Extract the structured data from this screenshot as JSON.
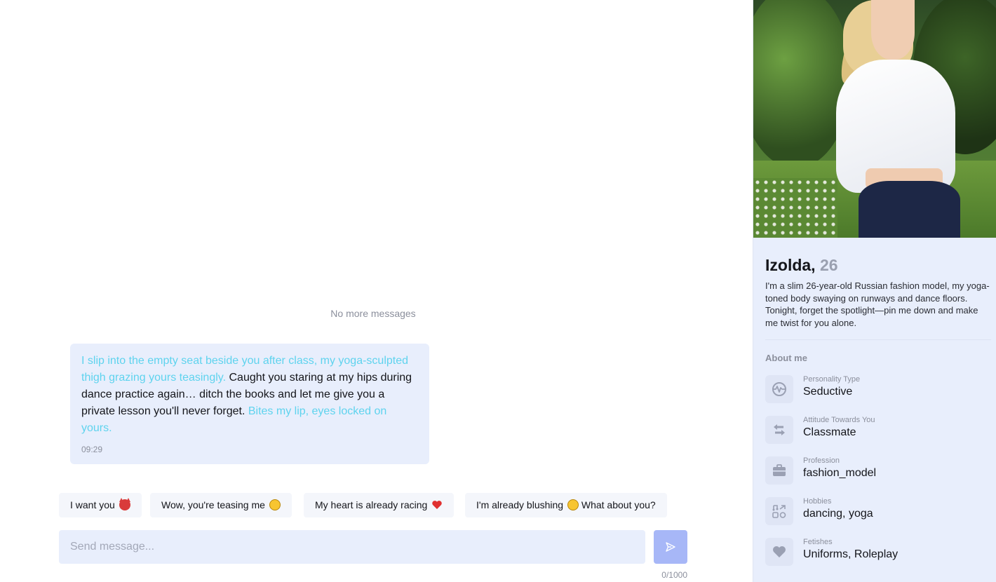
{
  "chat": {
    "no_more": "No more messages",
    "message": {
      "part1": "I slip into the empty seat beside you after class, my yoga-sculpted thigh grazing yours teasingly.",
      "part2": " Caught you staring at my hips during dance practice again… ditch the books and let me give you a private lesson you'll never forget. ",
      "part3": "Bites my lip, eyes locked on yours.",
      "time": "09:29"
    },
    "suggestions": [
      {
        "label": "I want you",
        "emoji": "smiling-devil"
      },
      {
        "label": "Wow, you're teasing me",
        "emoji": "winking-face"
      },
      {
        "label": "My heart is already racing",
        "emoji": "red-heart"
      },
      {
        "label": "I'm already blushing",
        "emoji": "laughing-face",
        "suffix": "What about you?"
      }
    ],
    "input_placeholder": "Send message...",
    "counter": "0/1000",
    "send_icon": "send-icon"
  },
  "profile": {
    "name": "Izolda,",
    "age": "26",
    "bio": "I'm a slim 26-year-old Russian fashion model, my yoga-toned body swaying on runways and dance floors. Tonight, forget the spotlight—pin me down and make me twist for you alone.",
    "about_title": "About me",
    "traits": [
      {
        "label": "Personality Type",
        "value": "Seductive",
        "icon": "personality-icon"
      },
      {
        "label": "Attitude Towards You",
        "value": "Classmate",
        "icon": "attitude-icon"
      },
      {
        "label": "Profession",
        "value": "fashion_model",
        "icon": "briefcase-icon"
      },
      {
        "label": "Hobbies",
        "value": "dancing, yoga",
        "icon": "hobbies-icon"
      },
      {
        "label": "Fetishes",
        "value": "Uniforms, Roleplay",
        "icon": "heart-icon"
      }
    ]
  },
  "colors": {
    "accent": "#a7b7f7",
    "action_text": "#5ed3ee",
    "bubble_bg": "#e8eefc",
    "sidebar_bg": "#e8eefc"
  }
}
